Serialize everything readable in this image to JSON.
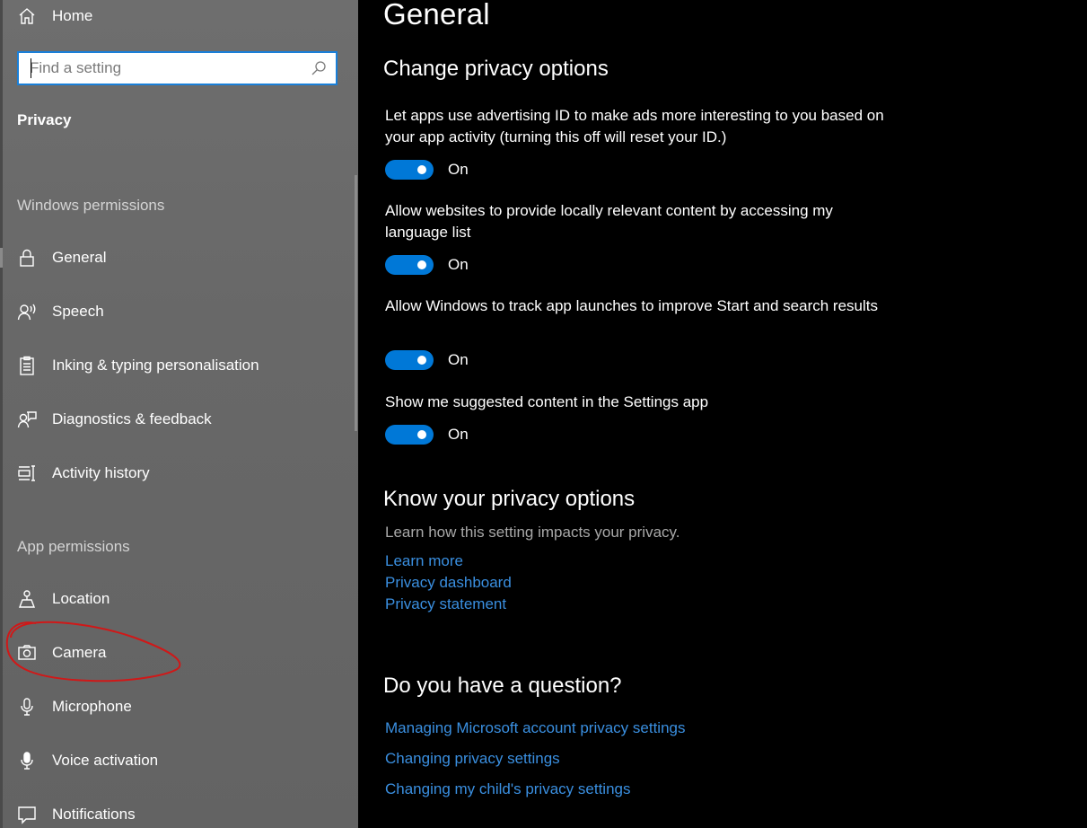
{
  "sidebar": {
    "home_label": "Home",
    "search_placeholder": "Find a setting",
    "section_title": "Privacy",
    "windows_permissions_label": "Windows permissions",
    "windows_items": [
      {
        "label": "General",
        "icon": "lock-icon"
      },
      {
        "label": "Speech",
        "icon": "speech-icon"
      },
      {
        "label": "Inking & typing personalisation",
        "icon": "clipboard-icon"
      },
      {
        "label": "Diagnostics & feedback",
        "icon": "diagnostics-icon"
      },
      {
        "label": "Activity history",
        "icon": "activity-icon"
      }
    ],
    "app_permissions_label": "App permissions",
    "app_items": [
      {
        "label": "Location",
        "icon": "location-icon"
      },
      {
        "label": "Camera",
        "icon": "camera-icon"
      },
      {
        "label": "Microphone",
        "icon": "microphone-icon"
      },
      {
        "label": "Voice activation",
        "icon": "voice-activation-icon"
      },
      {
        "label": "Notifications",
        "icon": "notifications-icon"
      }
    ]
  },
  "main": {
    "page_title": "General",
    "change_section": {
      "heading": "Change privacy options",
      "options": [
        {
          "description": "Let apps use advertising ID to make ads more interesting to you based on your app activity (turning this off will reset your ID.)",
          "state": "On"
        },
        {
          "description": "Allow websites to provide locally relevant content by accessing my language list",
          "state": "On"
        },
        {
          "description": "Allow Windows to track app launches to improve Start and search results",
          "state": "On"
        },
        {
          "description": "Show me suggested content in the Settings app",
          "state": "On"
        }
      ]
    },
    "know_section": {
      "heading": "Know your privacy options",
      "description": "Learn how this setting impacts your privacy.",
      "links": [
        "Learn more",
        "Privacy dashboard",
        "Privacy statement"
      ]
    },
    "question_section": {
      "heading": "Do you have a question?",
      "links": [
        "Managing Microsoft account privacy settings",
        "Changing privacy settings",
        "Changing my child's privacy settings"
      ]
    }
  },
  "colors": {
    "accent": "#0078d7",
    "link": "#3a8fe0",
    "annotation": "#d01818"
  }
}
